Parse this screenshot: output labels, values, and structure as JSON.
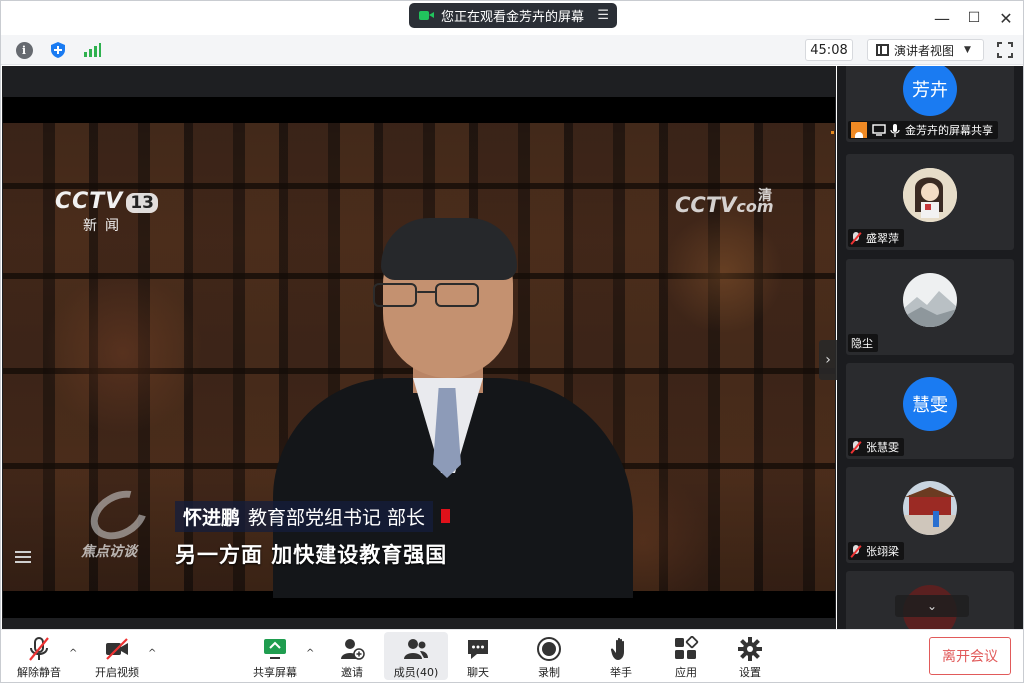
{
  "window": {
    "share_banner": "您正在观看金芳卉的屏幕",
    "minimize": "—",
    "maximize": "☐",
    "close": "✕"
  },
  "toolbar": {
    "info_icon": "i",
    "timer": "45:08",
    "view_mode": "演讲者视图",
    "view_caret": "▼"
  },
  "video": {
    "channel_logo": "CCTV",
    "channel_number": "13",
    "channel_sub": "新闻",
    "watermark": "CCTV",
    "watermark_com": "com",
    "watermark_hd": "清",
    "program_logo": "焦点访谈",
    "speaker_name": "怀进鹏",
    "speaker_title": "教育部党组书记  部长",
    "subtitle": "另一方面  加快建设教育强国",
    "side_arrow": "›"
  },
  "participants": [
    {
      "avatar_text": "芳卉",
      "name": "金芳卉的屏幕共享",
      "muted": false,
      "avatar_type": "blue"
    },
    {
      "avatar_text": "",
      "name": "盛翠萍",
      "muted": true,
      "avatar_type": "photo-girl"
    },
    {
      "avatar_text": "",
      "name": "隐尘",
      "muted": false,
      "avatar_type": "photo-mountain"
    },
    {
      "avatar_text": "慧雯",
      "name": "张慧雯",
      "muted": true,
      "avatar_type": "blue"
    },
    {
      "avatar_text": "",
      "name": "张翊梁",
      "muted": true,
      "avatar_type": "photo-gate"
    }
  ],
  "panel": {
    "scroll_down": "⌄"
  },
  "bottom": {
    "unmute": "解除静音",
    "start_video": "开启视频",
    "share_screen": "共享屏幕",
    "invite": "邀请",
    "members": "成员(40)",
    "chat": "聊天",
    "record": "录制",
    "raise_hand": "举手",
    "apps": "应用",
    "settings": "设置",
    "leave": "离开会议",
    "caret": "^"
  },
  "colors": {
    "accent_blue": "#1a7bf2",
    "leave_red": "#e15a5a",
    "signal_green": "#2fb14f",
    "share_green": "#21c45d"
  }
}
